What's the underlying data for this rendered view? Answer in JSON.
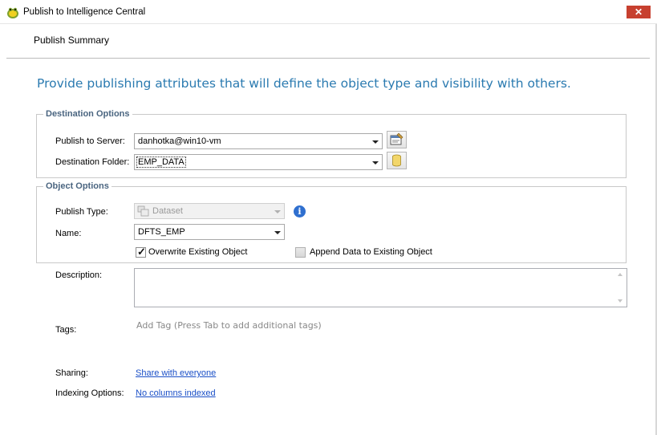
{
  "window": {
    "title": "Publish to Intelligence Central",
    "close_label": "✕"
  },
  "page": {
    "section_title": "Publish Summary",
    "heading": "Provide publishing attributes that will define the object type and visibility with others."
  },
  "destination_options": {
    "legend": "Destination Options",
    "server_label": "Publish to Server:",
    "server_value": "danhotka@win10-vm",
    "folder_label": "Destination Folder:",
    "folder_value": "EMP_DATA"
  },
  "object_options": {
    "legend": "Object Options",
    "type_label": "Publish Type:",
    "type_value": "Dataset",
    "name_label": "Name:",
    "name_value": "DFTS_EMP",
    "overwrite_label": "Overwrite Existing Object",
    "overwrite_checked": true,
    "append_label": "Append Data to Existing Object",
    "append_checked": false
  },
  "details": {
    "description_label": "Description:",
    "description_value": "",
    "tags_label": "Tags:",
    "tags_placeholder": "Add Tag (Press Tab to add additional tags)",
    "sharing_label": "Sharing:",
    "sharing_link": "Share with everyone",
    "indexing_label": "Indexing Options:",
    "indexing_link": "No columns indexed"
  },
  "colors": {
    "heading": "#2a7ab0",
    "legend": "#4a6580",
    "link": "#1a4fc7",
    "close_button": "#c7402f"
  },
  "icons": [
    "toad-app-icon",
    "close-icon",
    "server-properties-icon",
    "database-icon",
    "dataset-icon",
    "info-icon",
    "checkmark-icon"
  ]
}
